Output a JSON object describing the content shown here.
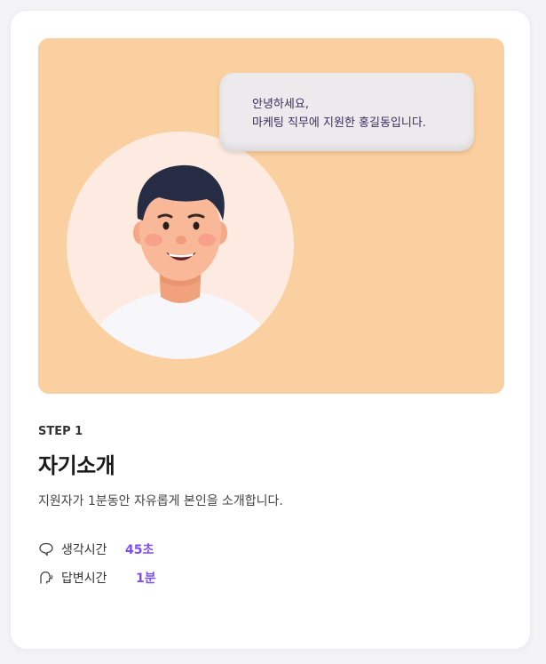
{
  "speech_bubble": {
    "line1": "안녕하세요,",
    "line2": "마케팅 직무에 지원한 홍길동입니다."
  },
  "step": {
    "label": "STEP 1",
    "title": "자기소개",
    "description": "지원자가 1분동안 자유롭게 본인을 소개합니다."
  },
  "timing": [
    {
      "label": "생각시간",
      "value": "45초",
      "icon": "thinking-bubble-icon"
    },
    {
      "label": "답변시간",
      "value": "1분",
      "icon": "speaking-head-icon"
    }
  ],
  "colors": {
    "hero_background": "#fbd0a1",
    "avatar_background": "#fdeae0",
    "accent": "#7b4dfa"
  }
}
